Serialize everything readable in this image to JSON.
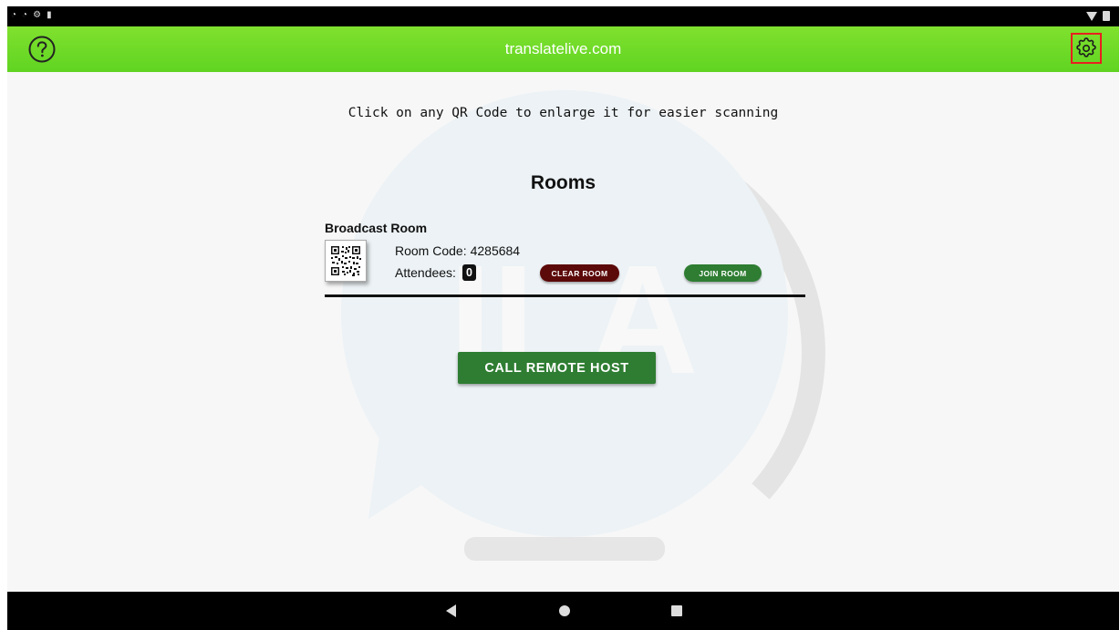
{
  "app_bar": {
    "title": "translatelive.com",
    "background": "#6ddb28",
    "help_icon": "help-circle-icon",
    "settings_icon": "gear-icon",
    "highlight_color": "#e8201f"
  },
  "main": {
    "hint": "Click on any QR Code to enlarge it for easier scanning",
    "rooms_title": "Rooms",
    "rooms": [
      {
        "name": "Broadcast Room",
        "code_label": "Room Code:",
        "code_value": "4285684",
        "attendees_label": "Attendees:",
        "attendees_count": "0",
        "clear_label": "CLEAR ROOM",
        "join_label": "JOIN ROOM"
      }
    ],
    "call_button": "CALL REMOTE HOST",
    "watermark_text": "ILA"
  },
  "nav": {
    "back_icon": "back-triangle-icon",
    "home_icon": "home-circle-icon",
    "recents_icon": "recents-square-icon"
  },
  "colors": {
    "clear_button": "#5c0909",
    "join_button": "#2e7d32",
    "call_button": "#2e7d32"
  }
}
